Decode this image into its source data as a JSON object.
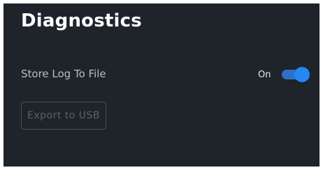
{
  "panel": {
    "title": "Diagnostics"
  },
  "settings": {
    "store_log": {
      "label": "Store Log To File",
      "state_text": "On",
      "enabled": true
    },
    "export_button_label": "Export to USB"
  },
  "colors": {
    "background": "#1f232a",
    "accent": "#2288f2",
    "track": "#2f6fc4"
  }
}
